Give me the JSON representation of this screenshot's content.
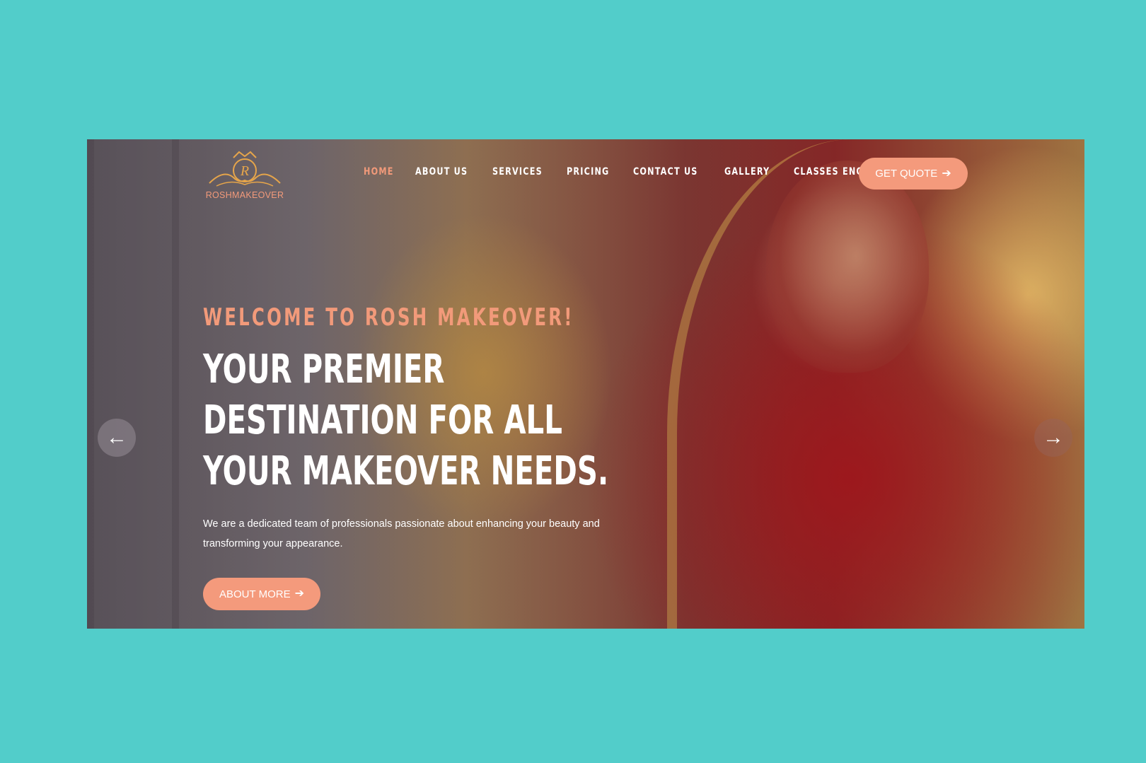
{
  "colors": {
    "background": "#52cdca",
    "accent": "#f49a7c",
    "nav_text": "#ffffff",
    "active_nav": "#f29a7a"
  },
  "logo": {
    "monogram": "R",
    "name": "ROSHMAKEOVER"
  },
  "nav": {
    "items": [
      {
        "label": "HOME",
        "active": true
      },
      {
        "label": "ABOUT US",
        "active": false
      },
      {
        "label": "SERVICES",
        "active": false
      },
      {
        "label": "PRICING",
        "active": false
      },
      {
        "label": "CONTACT US",
        "active": false
      },
      {
        "label": "GALLERY",
        "active": false
      },
      {
        "label": "CLASSES ENQUIRY",
        "active": false
      }
    ],
    "cta_label": "GET QUOTE",
    "cta_icon": "arrow-right-icon"
  },
  "hero": {
    "welcome": "WELCOME TO ROSH MAKEOVER!",
    "headline": "YOUR PREMIER DESTINATION FOR ALL YOUR MAKEOVER NEEDS.",
    "description": "We are a dedicated team of professionals passionate about enhancing your beauty and transforming your appearance.",
    "button_label": "ABOUT MORE",
    "button_icon": "arrow-right-icon",
    "prev_icon": "arrow-left-icon",
    "next_icon": "arrow-right-icon",
    "image": "bride-photo"
  }
}
